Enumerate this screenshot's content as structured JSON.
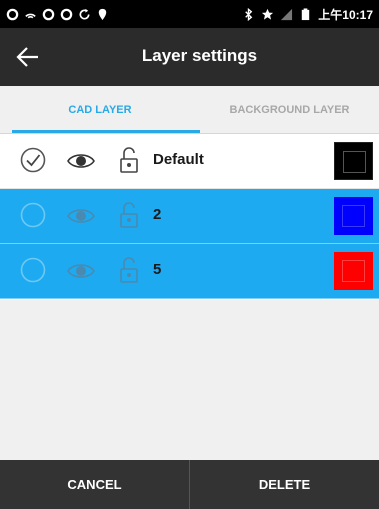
{
  "status_bar": {
    "time": "上午10:17",
    "left_icons": [
      "notification-icon",
      "wifi-icon",
      "notification-icon",
      "notification-icon",
      "sync-icon",
      "location-icon"
    ],
    "right_icons": [
      "bluetooth-icon",
      "star-icon",
      "signal-icon",
      "battery-icon"
    ]
  },
  "app_bar": {
    "title": "Layer settings",
    "back_icon": "arrow-left-icon"
  },
  "tabs": [
    {
      "label": "CAD LAYER",
      "active": true
    },
    {
      "label": "BACKGROUND LAYER",
      "active": false
    }
  ],
  "layers": [
    {
      "name": "Default",
      "checked": true,
      "selected": false,
      "visible": true,
      "locked": false,
      "color": "#000000"
    },
    {
      "name": "2",
      "checked": false,
      "selected": true,
      "visible": true,
      "locked": false,
      "color": "#0000ff"
    },
    {
      "name": "5",
      "checked": false,
      "selected": true,
      "visible": true,
      "locked": false,
      "color": "#ff0000"
    }
  ],
  "bottom_bar": {
    "cancel_label": "CANCEL",
    "delete_label": "DELETE"
  },
  "colors": {
    "accent": "#29a9e6",
    "selected_row": "#1eaaf1",
    "app_bar": "#2b2b2b",
    "bottom_bar": "#333333"
  }
}
